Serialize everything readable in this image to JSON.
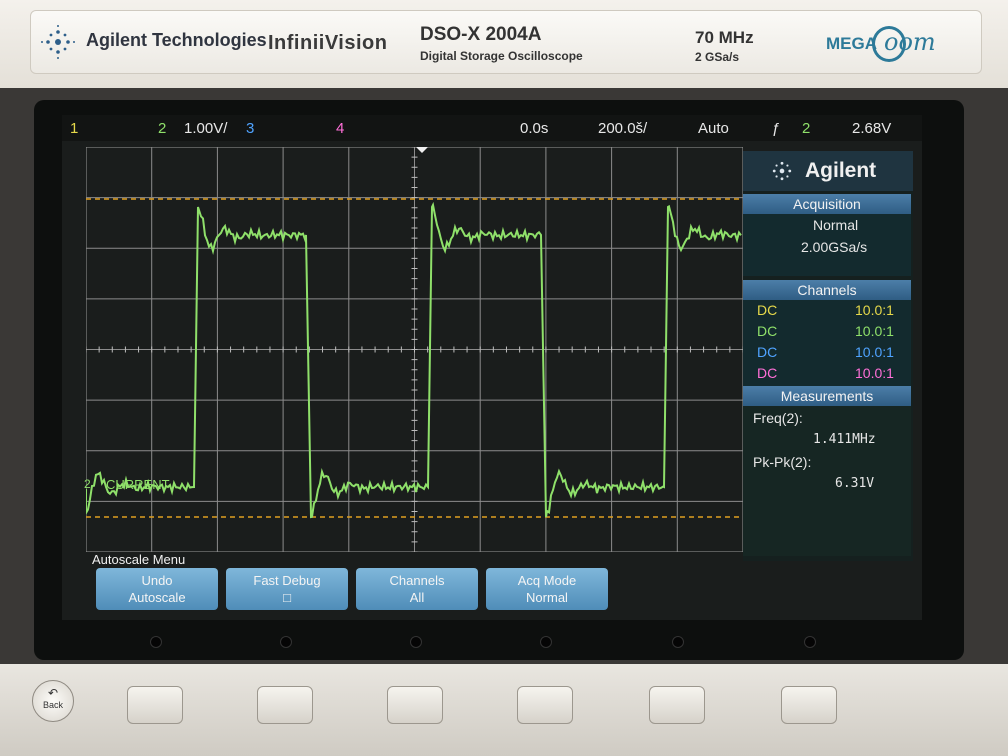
{
  "instrument": {
    "company": "Agilent Technologies",
    "product": "InfiniiVision",
    "model": "DSO-X 2004A",
    "model_subtitle": "Digital Storage Oscilloscope",
    "bandwidth": "70 MHz",
    "sample_rate": "2 GSa/s",
    "badge_mega": "MEGA",
    "badge_zoom": "oom"
  },
  "topbar": {
    "ch1": "1",
    "ch2": "2",
    "ch2_scale": "1.00V/",
    "ch3": "3",
    "ch4": "4",
    "time_delay": "0.0s",
    "time_scale": "200.0š/",
    "trigger_mode": "Auto",
    "trigger_icon": "ƒ",
    "trigger_source": "2",
    "trigger_level": "2.68V"
  },
  "trace": {
    "label": "CURRENT",
    "channel_marker": "2",
    "color": "#8fe06a"
  },
  "panel": {
    "brand": "Agilent",
    "acquisition": {
      "title": "Acquisition",
      "mode": "Normal",
      "rate": "2.00GSa/s"
    },
    "channels": {
      "title": "Channels",
      "rows": [
        {
          "coupling": "DC",
          "probe": "10.0:1",
          "color": "#e6d94a"
        },
        {
          "coupling": "DC",
          "probe": "10.0:1",
          "color": "#8fe06a"
        },
        {
          "coupling": "DC",
          "probe": "10.0:1",
          "color": "#4fa3ff"
        },
        {
          "coupling": "DC",
          "probe": "10.0:1",
          "color": "#ff6fd8"
        }
      ]
    },
    "measurements": {
      "title": "Measurements",
      "freq_label": "Freq(2):",
      "freq_value": "1.411MHz",
      "pkpk_label": "Pk-Pk(2):",
      "pkpk_value": "6.31V"
    }
  },
  "menu": {
    "title": "Autoscale Menu",
    "softkeys": [
      {
        "line1": "Undo",
        "line2": "Autoscale"
      },
      {
        "line1": "Fast Debug",
        "line2": "□"
      },
      {
        "line1": "Channels",
        "line2": "All"
      },
      {
        "line1": "Acq Mode",
        "line2": "Normal"
      }
    ]
  },
  "back_button": "Back",
  "colors": {
    "ch1": "#e6d94a",
    "ch2": "#8fe06a",
    "ch3": "#4fa3ff",
    "ch4": "#ff6fd8",
    "panel_header": "#3f72a0",
    "softkey": "#6aa6cf",
    "cursor": "#e0a020"
  },
  "icons": {
    "brand_logo": "agilent-spark-icon",
    "trigger": "rising-edge-trigger-icon",
    "back": "back-arrow-icon"
  }
}
